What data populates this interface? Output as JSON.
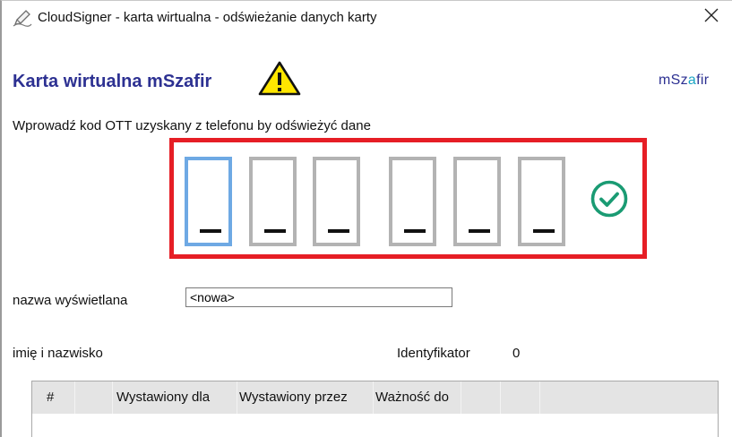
{
  "window": {
    "title": "CloudSigner - karta wirtualna - odświeżanie danych karty",
    "close_glyph": "✕"
  },
  "header": {
    "title": "Karta wirtualna mSzafir",
    "warning_icon": "warning-triangle-icon",
    "brand_main": "mSz",
    "brand_accent": "a",
    "brand_end": "fir",
    "brand_accent_color": "#1aa5c4",
    "title_color": "#2d3192"
  },
  "otp": {
    "instruction": "Wprowadź kod OTT uzyskany z telefonu by odświeżyć dane",
    "digits": [
      "",
      "",
      "",
      "",
      "",
      ""
    ],
    "active_index": 0,
    "frame_color": "#e61e25",
    "status_icon": "check-circle-icon",
    "status_color": "#1a9b73"
  },
  "form": {
    "display_name_label": "nazwa wyświetlana",
    "display_name_value": "<nowa>",
    "full_name_label": "imię i nazwisko",
    "identifier_label": "Identyfikator",
    "identifier_value": "0"
  },
  "table": {
    "columns": [
      "#",
      "",
      "Wystawiony dla",
      "Wystawiony przez",
      "Ważność do",
      "",
      ""
    ],
    "rows": []
  }
}
